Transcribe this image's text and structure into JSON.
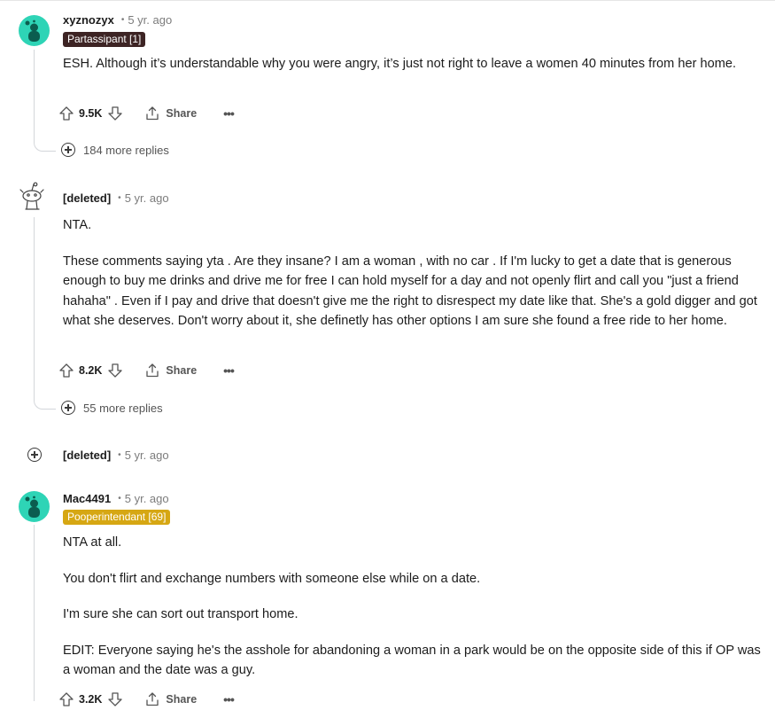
{
  "comments": [
    {
      "author": "xyznozyx",
      "time": "5 yr. ago",
      "flair": "Partassipant [1]",
      "paragraphs": [
        "ESH. Although it’s understandable why you were angry, it’s just not right to leave a women 40 minutes from her home."
      ],
      "votes": "9.5K",
      "share_label": "Share",
      "more_replies": "184 more replies"
    },
    {
      "author": "[deleted]",
      "time": "5 yr. ago",
      "paragraphs": [
        "NTA.",
        "These comments saying yta . Are they insane? I am a woman , with no car . If I'm lucky to get a date that is generous enough to buy me drinks and drive me for free I can hold myself for a day and not openly flirt and call you \"just a friend hahaha\" . Even if I pay and drive that doesn't give me the right to disrespect my date like that. She's a gold digger and got what she deserves. Don't worry about it, she definetly has other options I am sure she found a free ride to her home."
      ],
      "votes": "8.2K",
      "share_label": "Share",
      "more_replies": "55 more replies"
    },
    {
      "author": "[deleted]",
      "time": "5 yr. ago",
      "collapsed": true
    },
    {
      "author": "Mac4491",
      "time": "5 yr. ago",
      "flair": "Pooperintendant [69]",
      "paragraphs": [
        "NTA at all.",
        "You don't flirt and exchange numbers with someone else while on a date.",
        "I'm sure she can sort out transport home.",
        "EDIT: Everyone saying he's the asshole for abandoning a woman in a park would be on the opposite side of this if OP was a woman and the date was a guy."
      ],
      "votes": "3.2K",
      "share_label": "Share"
    }
  ],
  "colors": {
    "avatar": "#2ed4b6",
    "flair_dark": "#3d2424",
    "flair_gold": "#d6a713"
  },
  "icons": [
    "upvote-icon",
    "downvote-icon",
    "share-icon",
    "overflow-icon",
    "expand-icon",
    "snoo-avatar-icon"
  ]
}
